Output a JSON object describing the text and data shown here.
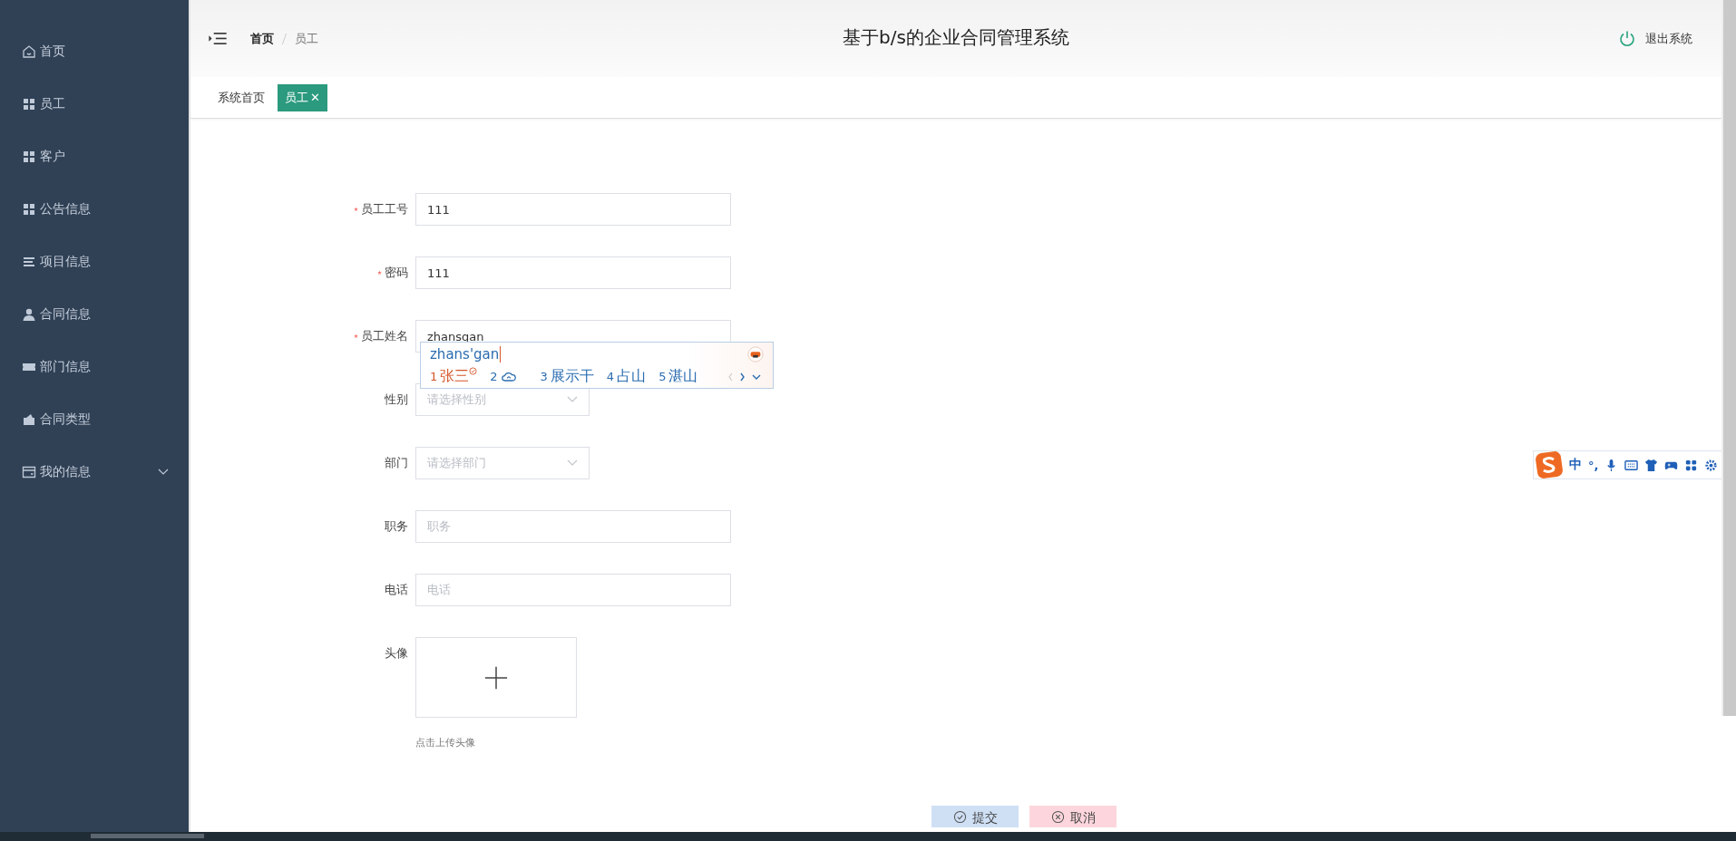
{
  "sidebar": {
    "items": [
      {
        "label": "首页",
        "kind": "home"
      },
      {
        "label": "员工",
        "kind": "grid"
      },
      {
        "label": "客户",
        "kind": "grid"
      },
      {
        "label": "公告信息",
        "kind": "grid"
      },
      {
        "label": "项目信息",
        "kind": "list"
      },
      {
        "label": "合同信息",
        "kind": "user"
      },
      {
        "label": "部门信息",
        "kind": "ticket"
      },
      {
        "label": "合同类型",
        "kind": "wallet"
      },
      {
        "label": "我的信息",
        "kind": "card",
        "expanded": false
      }
    ]
  },
  "header": {
    "breadcrumb": [
      "首页",
      "员工"
    ],
    "title": "基于b/s的企业合同管理系统",
    "logout": "退出系统"
  },
  "tabs": [
    {
      "label": "系统首页",
      "selected": false
    },
    {
      "label": "员工",
      "selected": true,
      "close": "✕"
    }
  ],
  "form": {
    "fields": [
      {
        "kind": "input",
        "label": "员工工号",
        "required": true,
        "value": "111"
      },
      {
        "kind": "input",
        "label": "密码",
        "required": true,
        "value": "111"
      },
      {
        "kind": "input",
        "label": "员工姓名",
        "required": true,
        "value": "zhansgan"
      },
      {
        "kind": "select",
        "label": "性别",
        "required": false,
        "placeholder": "请选择性别"
      },
      {
        "kind": "select",
        "label": "部门",
        "required": false,
        "placeholder": "请选择部门"
      },
      {
        "kind": "input",
        "label": "职务",
        "required": false,
        "placeholder": "职务"
      },
      {
        "kind": "input",
        "label": "电话",
        "required": false,
        "placeholder": "电话"
      },
      {
        "kind": "upload",
        "label": "头像",
        "required": false,
        "hint": "点击上传头像"
      }
    ],
    "buttons": [
      {
        "label": "提交",
        "kind": "submit"
      },
      {
        "label": "取消",
        "kind": "cancel"
      }
    ]
  },
  "ime_popup": {
    "composition": "zhans'gan",
    "candidates": [
      {
        "number": "1",
        "text": "张三",
        "selected": true
      },
      {
        "number": "2",
        "kind": "cloud",
        "selected": false
      },
      {
        "number": "3",
        "text": "展示干",
        "selected": false
      },
      {
        "number": "4",
        "text": "占山",
        "selected": false
      },
      {
        "number": "5",
        "text": "湛山",
        "selected": false
      }
    ]
  },
  "ime_toolbar": {
    "mode": "中",
    "punct": "°,"
  }
}
